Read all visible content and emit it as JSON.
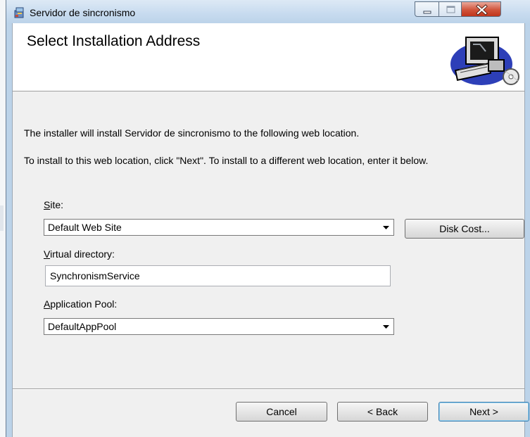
{
  "window": {
    "title": "Servidor de sincronismo",
    "controls": {
      "minimize_icon": "minimize-icon",
      "maximize_icon": "maximize-icon",
      "close_icon": "close-icon"
    }
  },
  "banner": {
    "title": "Select Installation Address",
    "art_icon": "computer-setup-icon"
  },
  "body": {
    "line1": "The installer will install Servidor de sincronismo to the following web location.",
    "line2": "To install to this web location, click \"Next\". To install to a different web location, enter it below."
  },
  "site": {
    "label_first": "S",
    "label_rest": "ite:",
    "value": "Default Web Site"
  },
  "disk_cost_label": "Disk Cost...",
  "virtual_directory": {
    "label_first": "V",
    "label_rest": "irtual directory:",
    "value": "SynchronismService"
  },
  "application_pool": {
    "label_first": "A",
    "label_rest": "pplication Pool:",
    "value": "DefaultAppPool"
  },
  "footer": {
    "cancel_label": "Cancel",
    "back_label": "< Back",
    "next_label": "Next >"
  },
  "colors": {
    "frame": "#bcd3e9",
    "close_button": "#c7432b",
    "dialog_background": "#f0f0f0"
  }
}
